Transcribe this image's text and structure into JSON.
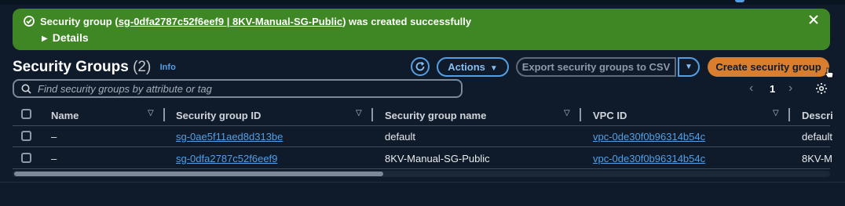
{
  "flash": {
    "prefix": "Security group (",
    "link_text": "sg-0dfa2787c52f6eef9 | 8KV-Manual-SG-Public",
    "suffix": ") was created successfully",
    "details_label": "Details",
    "color": "#3f8624"
  },
  "header": {
    "title": "Security Groups",
    "count": "(2)",
    "info": "Info"
  },
  "toolbar": {
    "refresh_icon": "refresh-icon",
    "actions_label": "Actions",
    "export_label": "Export security groups to CSV",
    "create_label": "Create security group",
    "accent": "#539fe5",
    "primary_color": "#d97e2f"
  },
  "search": {
    "placeholder": "Find security groups by attribute or tag"
  },
  "pagination": {
    "current_page": "1"
  },
  "table": {
    "columns": [
      "Name",
      "Security group ID",
      "Security group name",
      "VPC ID",
      "Descri"
    ],
    "rows": [
      {
        "name": "–",
        "sg_id": "sg-0ae5f11aed8d313be",
        "sg_name": "default",
        "vpc_id": "vpc-0de30f0b96314b54c",
        "description": "default"
      },
      {
        "name": "–",
        "sg_id": "sg-0dfa2787c52f6eef9",
        "sg_name": "8KV-Manual-SG-Public",
        "vpc_id": "vpc-0de30f0b96314b54c",
        "description": "8KV-M"
      }
    ]
  }
}
